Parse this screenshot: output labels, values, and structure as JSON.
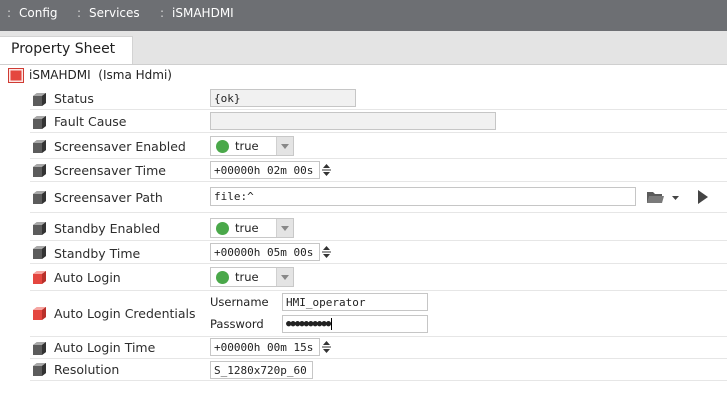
{
  "breadcrumb": [
    {
      "sep": ":",
      "label": "Config"
    },
    {
      "sep": ":",
      "label": "Services"
    },
    {
      "sep": ":",
      "label": "iSMAHDMI"
    }
  ],
  "tab": {
    "label": "Property Sheet"
  },
  "root": {
    "label": "iSMAHDMI  (Isma Hdmi)"
  },
  "properties": {
    "status": {
      "name": "Status",
      "value": "{ok}"
    },
    "fault_cause": {
      "name": "Fault Cause",
      "value": ""
    },
    "screensaver_enabled": {
      "name": "Screensaver Enabled",
      "value": "true"
    },
    "screensaver_time": {
      "name": "Screensaver Time",
      "value": "+00000h 02m 00s"
    },
    "screensaver_path": {
      "name": "Screensaver Path",
      "value": "file:^"
    },
    "standby_enabled": {
      "name": "Standby Enabled",
      "value": "true"
    },
    "standby_time": {
      "name": "Standby Time",
      "value": "+00000h 05m 00s"
    },
    "auto_login": {
      "name": "Auto Login",
      "value": "true"
    },
    "auto_login_credentials": {
      "name": "Auto Login Credentials",
      "username_label": "Username",
      "username": "HMI_operator",
      "password_label": "Password",
      "password": "●●●●●●●●●●"
    },
    "auto_login_time": {
      "name": "Auto Login Time",
      "value": "+00000h 00m 15s"
    },
    "resolution": {
      "name": "Resolution",
      "value": "S_1280x720p_60"
    }
  },
  "colors": {
    "breadcrumb_bg": "#6d6f73",
    "status_on": "#4aa84a",
    "slot_normal": "#444444",
    "slot_config": "#e4463f"
  },
  "icons": [
    "slot-icon",
    "component-icon",
    "folder-icon",
    "dropdown-arrow-icon",
    "play-icon",
    "spinner-icon"
  ]
}
